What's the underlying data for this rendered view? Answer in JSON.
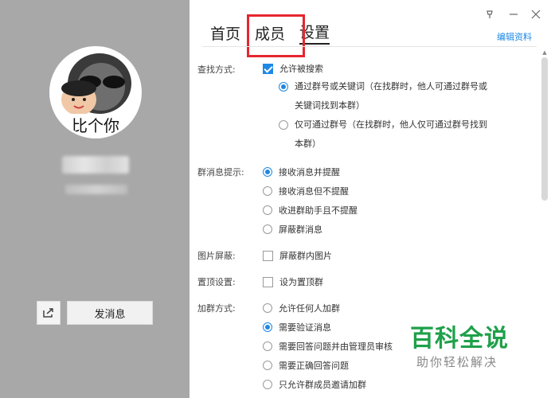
{
  "window": {
    "controls": [
      "pin",
      "minimize",
      "close"
    ]
  },
  "sidebar": {
    "avatar_caption": "比个你",
    "send_message_label": "发消息"
  },
  "tabs": [
    {
      "label": "首页",
      "active": false
    },
    {
      "label": "成员",
      "active": false,
      "highlighted": true
    },
    {
      "label": "设置",
      "active": true
    }
  ],
  "edit_link": "编辑资料",
  "settings": {
    "search": {
      "label": "查找方式:",
      "allow_search": {
        "label": "允许被搜索",
        "checked": true
      },
      "by_keyword": {
        "line1": "通过群号或关键词（在找群时，他人可通过群号或",
        "line2": "关键词找到本群）",
        "selected": true
      },
      "by_number": {
        "line1": "仅可通过群号（在找群时，他人仅可通过群号找到",
        "line2": "本群）",
        "selected": false
      }
    },
    "notify": {
      "label": "群消息提示:",
      "options": [
        {
          "label": "接收消息并提醒",
          "selected": true
        },
        {
          "label": "接收消息但不提醒",
          "selected": false
        },
        {
          "label": "收进群助手且不提醒",
          "selected": false
        },
        {
          "label": "屏蔽群消息",
          "selected": false
        }
      ]
    },
    "image_block": {
      "label": "图片屏蔽:",
      "option": "屏蔽群内图片",
      "checked": false
    },
    "pin_top": {
      "label": "置顶设置:",
      "option": "设为置顶群",
      "checked": false
    },
    "join": {
      "label": "加群方式:",
      "options": [
        {
          "label": "允许任何人加群",
          "selected": false
        },
        {
          "label": "需要验证消息",
          "selected": true
        },
        {
          "label": "需要回答问题并由管理员审核",
          "selected": false
        },
        {
          "label": "需要正确回答问题",
          "selected": false
        },
        {
          "label": "只允许群成员邀请加群",
          "selected": false
        }
      ]
    }
  },
  "watermark": {
    "title": "百科全说",
    "subtitle": "助你轻松解决"
  },
  "colors": {
    "accent": "#1e88e5",
    "highlight_box": "#e6262e",
    "watermark_green": "#1fa04a",
    "sidebar_bg": "#a8a8a8"
  }
}
